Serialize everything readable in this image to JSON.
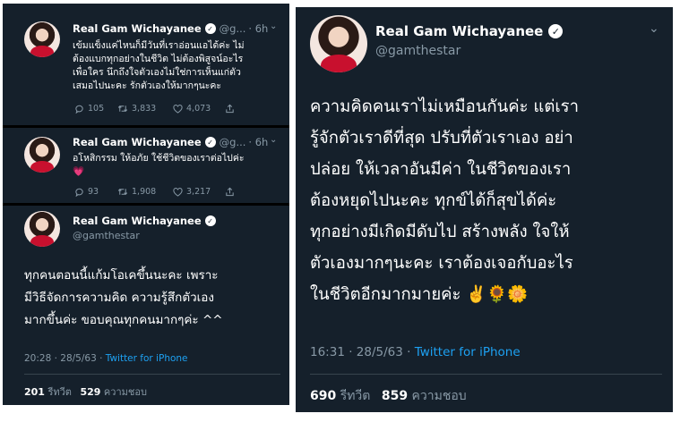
{
  "left": {
    "tweet1": {
      "name": "Real Gam Wichayanee",
      "handle": "@g...",
      "time": "· 6h",
      "lines": [
        "เข้มแข็งแค่ไหนก็มีวันที่เราอ่อนแอได้ค่ะ ไม่",
        "ต้องแบกทุกอย่างในชีวิต ไม่ต้องพิสูจน์อะไร",
        "เพื่อใคร นึกถึงใจตัวเองไม่ใช่การเห็นแก่ตัว",
        "เสมอไปนะคะ รักตัวเองให้มากๆนะคะ"
      ],
      "replies": "105",
      "retweets": "3,833",
      "likes": "4,073"
    },
    "tweet2": {
      "name": "Real Gam Wichayanee",
      "handle": "@g...",
      "time": "· 6h",
      "lines": [
        "อโหสิกรรม ให้อภัย ใช้ชีวิตของเราต่อไปค่ะ",
        "💗"
      ],
      "replies": "93",
      "retweets": "1,908",
      "likes": "3,217"
    },
    "tweet3": {
      "name": "Real Gam Wichayanee",
      "handle": "@gamthestar",
      "lines": [
        "ทุกคนตอนนี้แก้มโอเคขึ้นนะคะ เพราะ",
        "มีวิธีจัดการความคิด ความรู้สึกตัวเอง",
        "มากขึ้นค่ะ ขอบคุณทุกคนมากๆค่ะ ^^"
      ],
      "time": "20:28 · 28/5/63 · ",
      "source": "Twitter for iPhone",
      "retweets_count": "201",
      "retweets_label": "รีทวีต",
      "likes_count": "529",
      "likes_label": "ความชอบ"
    }
  },
  "right": {
    "name": "Real Gam Wichayanee",
    "handle": "@gamthestar",
    "lines": [
      "ความคิดคนเราไม่เหมือนกันค่ะ แต่เรา",
      "รู้จักตัวเราดีที่สุด ปรับที่ตัวเราเอง อย่า",
      "ปล่อย ให้เวลาอันมีค่า ในชีวิตของเรา",
      "ต้องหยุดไปนะคะ ทุกข์ได้ก็สุขได้ค่ะ",
      "ทุกอย่างมีเกิดมีดับไป สร้างพลัง ใจให้",
      "ตัวเองมากๆนะคะ เราต้องเจอกับอะไร",
      "ในชีวิตอีกมากมายค่ะ ✌️🌻🌼"
    ],
    "time": "16:31 · 28/5/63 · ",
    "source": "Twitter for iPhone",
    "retweets_count": "690",
    "retweets_label": "รีทวีต",
    "likes_count": "859",
    "likes_label": "ความชอบ"
  },
  "icons": {
    "verified": "verified-badge-icon",
    "chevron": "chevron-down-icon",
    "reply": "reply-icon",
    "retweet": "retweet-icon",
    "like": "heart-icon",
    "share": "share-icon"
  },
  "colors": {
    "background": "#15202b",
    "secondary_text": "#8899a6",
    "link": "#1da1f2",
    "divider": "#38444d"
  }
}
